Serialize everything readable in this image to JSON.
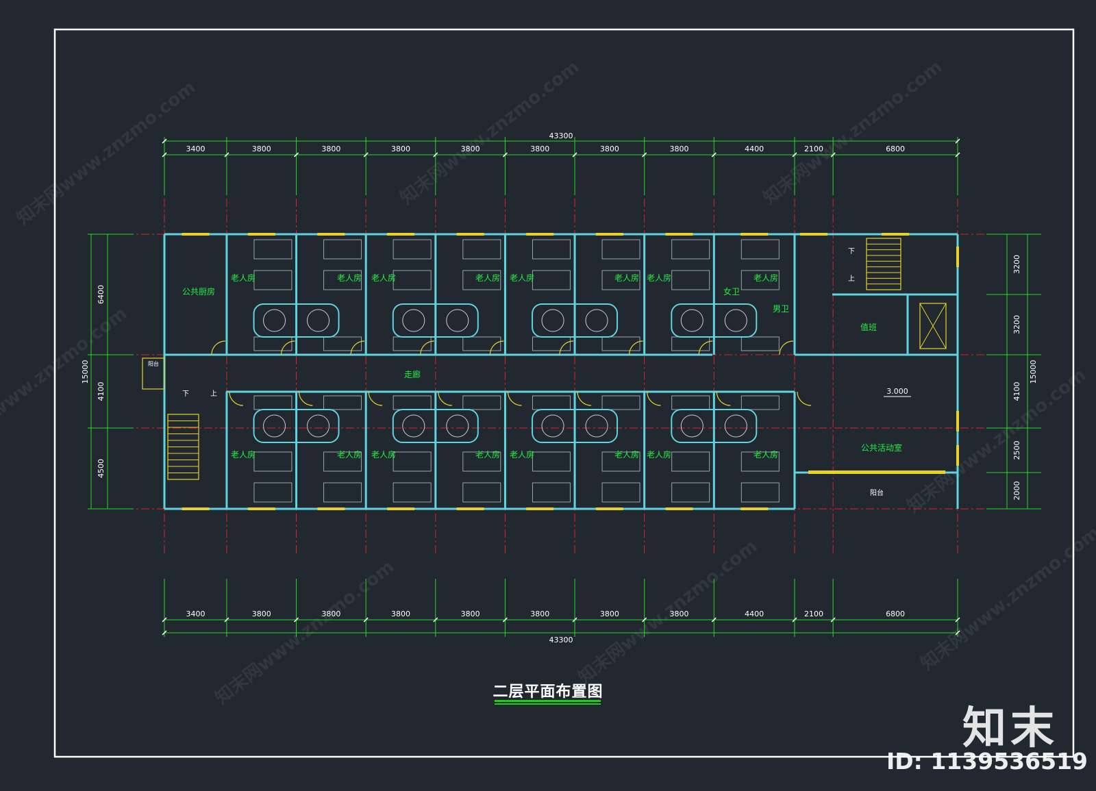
{
  "drawing": {
    "title": "二层平面布置图",
    "total_dimension": "43300",
    "column_spacings": [
      "3400",
      "3800",
      "3800",
      "3800",
      "3800",
      "3800",
      "3800",
      "3800",
      "4400",
      "2100",
      "6800"
    ],
    "right_row_dims": [
      "3200",
      "3200",
      "4100",
      "2500",
      "2000"
    ],
    "left_row_dims": [
      "6400",
      "4100",
      "4500"
    ],
    "overall_depth": "15000",
    "elevation": "3.000"
  },
  "rooms": {
    "public_kitchen": "公共厨房",
    "elder_room": "老人房",
    "women_wc": "女卫",
    "men_wc": "男卫",
    "duty_room": "值班",
    "corridor": "走廊",
    "activity_room": "公共活动室",
    "balcony": "阳台",
    "stair_down": "下",
    "stair_up": "上"
  },
  "watermark": {
    "logo": "知末",
    "id": "ID: 1139536519",
    "site": "知末网www.znzmo.com"
  },
  "colors": {
    "background": "#212830",
    "wall": "#5fd4e0",
    "dimension": "#22dd22",
    "axis": "#e02222",
    "window": "#e6d22a",
    "room_label": "#22ee44"
  }
}
